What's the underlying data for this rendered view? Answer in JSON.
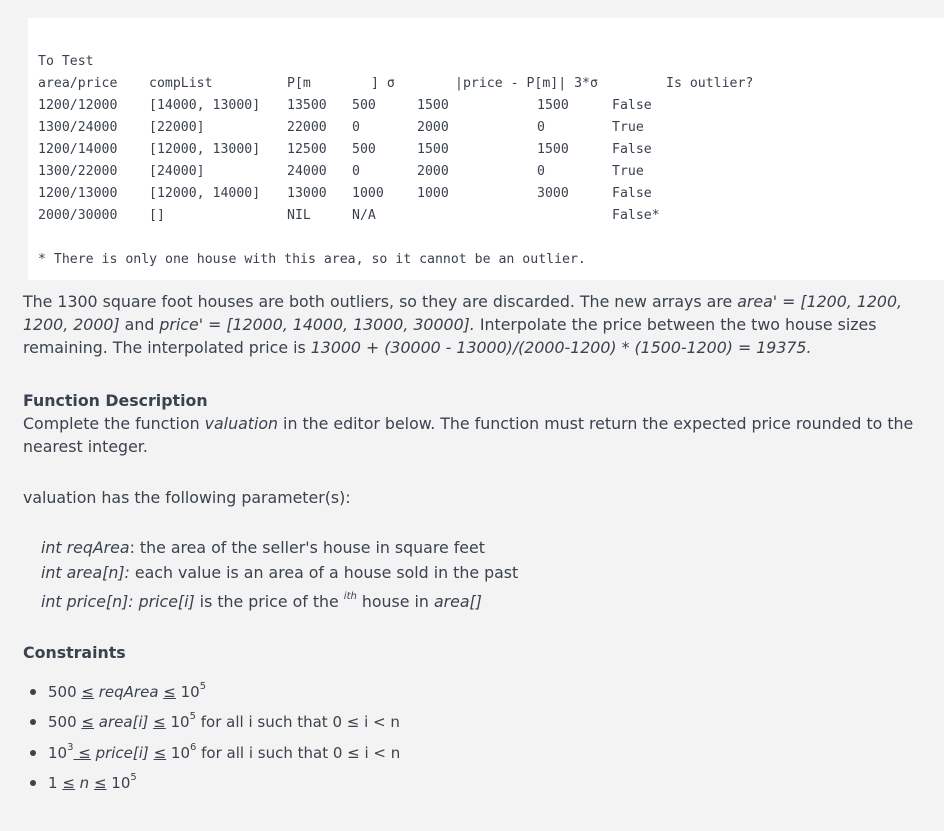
{
  "code_block": {
    "title": "To Test",
    "header": {
      "c1": "area/price",
      "c2": "compList",
      "c3": "P[m",
      "c4": "] σ",
      "c5": "|price - P[m]| 3*σ",
      "c6": "Is outlier?"
    },
    "rows": [
      [
        "1200/12000",
        "[14000, 13000]",
        "13500",
        "500",
        "1500",
        "1500",
        "False"
      ],
      [
        "1300/24000",
        "[22000]",
        "22000",
        "0",
        "2000",
        "0",
        "True"
      ],
      [
        "1200/14000",
        "[12000, 13000]",
        "12500",
        "500",
        "1500",
        "1500",
        "False"
      ],
      [
        "1300/22000",
        "[24000]",
        "24000",
        "0",
        "2000",
        "0",
        "True"
      ],
      [
        "1200/13000",
        "[12000, 14000]",
        "13000",
        "1000",
        "1000",
        "3000",
        "False"
      ],
      [
        "2000/30000",
        "[]",
        "NIL",
        "N/A",
        "",
        "",
        "False*"
      ]
    ],
    "footnote": "* There is only one house with this area, so it cannot be an outlier."
  },
  "paragraph1": {
    "part1": "The 1300 square foot houses are both outliers, so they are discarded. The new arrays are ",
    "area_prime": "area' = [1200, 1200, 1200, 2000]",
    "part2": " and ",
    "price_prime": "price' = [12000, 14000, 13000, 30000].",
    "part3": " Interpolate the price between the two house sizes remaining. The interpolated price is ",
    "formula": "13000 + (30000 - 13000)/(2000-1200) * (1500-1200) = 19375."
  },
  "function_description": {
    "heading": "Function Description",
    "text1": "Complete the function ",
    "fn_name": "valuation",
    "text2": " in the editor below. The function must return the expected price rounded to the nearest integer."
  },
  "params_intro": "valuation has the following parameter(s):",
  "params": [
    {
      "name": "int reqArea",
      "desc": ": the area of the seller's house in square feet"
    },
    {
      "name": "int area[n]:",
      "desc": " each value is an area of a house sold in the past"
    },
    {
      "name": "int price[n]: price[i]",
      "desc": " is the price of the ",
      "sup": "ith",
      "desc2": " house in ",
      "tail": "area[]"
    }
  ],
  "constraints": {
    "heading": "Constraints",
    "items": [
      {
        "pre": "500 ",
        "le1": "≤",
        "var": " reqArea ",
        "le2": "≤",
        "post": " 10",
        "sup": "5",
        "tail": ""
      },
      {
        "pre": "500 ",
        "le1": "≤",
        "var": " area[i] ",
        "le2": "≤",
        "post": " 10",
        "sup": "5",
        "tail": " for all i such that 0 ≤ i < n"
      },
      {
        "pre": "10",
        "sup0": "3",
        "le1": " ≤",
        "var": " price[i] ",
        "le2": "≤",
        "post": " 10",
        "sup": "6",
        "tail": " for all i such that 0 ≤ i < n"
      },
      {
        "pre": "1 ",
        "le1": "≤",
        "var": " n ",
        "le2": "≤",
        "post": " 10",
        "sup": "5",
        "tail": ""
      }
    ]
  }
}
